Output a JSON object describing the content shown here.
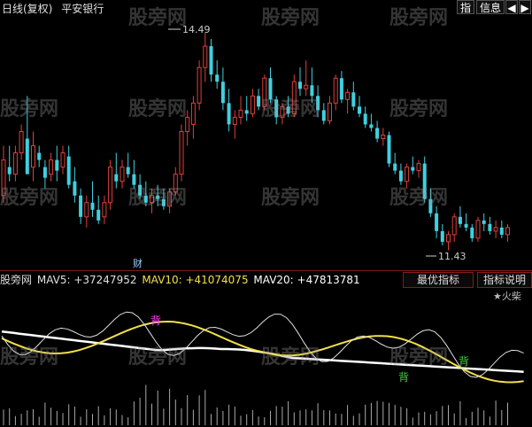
{
  "header": {
    "period": "日线(复权)",
    "stock_name": "平安银行",
    "btn_zhi": "指",
    "btn_info": "信息",
    "btn_prev": "◀",
    "btn_next": "▶"
  },
  "main": {
    "high_label": "14.49",
    "low_label": "11.43",
    "cai_label": "财",
    "candles": [
      [
        12.2,
        12.9,
        12.1,
        12.7
      ],
      [
        12.6,
        12.9,
        12.4,
        12.5
      ],
      [
        12.5,
        12.9,
        12.4,
        12.8
      ],
      [
        12.8,
        13.2,
        12.7,
        13.1
      ],
      [
        13.0,
        13.6,
        12.9,
        12.5
      ],
      [
        12.6,
        13.1,
        12.4,
        12.9
      ],
      [
        12.8,
        12.9,
        12.6,
        12.7
      ],
      [
        12.6,
        12.7,
        12.3,
        12.45
      ],
      [
        12.5,
        12.8,
        12.4,
        12.7
      ],
      [
        12.7,
        12.9,
        12.4,
        12.55
      ],
      [
        12.6,
        12.9,
        12.5,
        12.8
      ],
      [
        12.75,
        12.9,
        12.3,
        12.35
      ],
      [
        12.4,
        12.6,
        12.1,
        12.2
      ],
      [
        12.2,
        12.3,
        11.8,
        11.9
      ],
      [
        11.9,
        12.2,
        11.75,
        12.1
      ],
      [
        12.1,
        12.4,
        11.9,
        12.0
      ],
      [
        12.0,
        12.2,
        11.8,
        11.85
      ],
      [
        11.9,
        12.2,
        11.8,
        12.1
      ],
      [
        12.1,
        12.7,
        12.0,
        12.6
      ],
      [
        12.5,
        12.8,
        12.3,
        12.4
      ],
      [
        12.4,
        12.7,
        12.3,
        12.6
      ],
      [
        12.6,
        12.8,
        12.45,
        12.5
      ],
      [
        12.5,
        12.7,
        12.3,
        12.35
      ],
      [
        12.35,
        12.5,
        12.15,
        12.2
      ],
      [
        12.2,
        12.4,
        12.05,
        12.1
      ],
      [
        12.1,
        12.3,
        11.95,
        12.2
      ],
      [
        12.2,
        12.35,
        12.05,
        12.15
      ],
      [
        12.15,
        12.3,
        12.0,
        12.05
      ],
      [
        12.05,
        12.3,
        11.95,
        12.25
      ],
      [
        12.25,
        12.6,
        12.2,
        12.5
      ],
      [
        12.5,
        13.2,
        12.4,
        13.1
      ],
      [
        13.1,
        13.4,
        12.9,
        13.3
      ],
      [
        13.2,
        13.6,
        13.0,
        13.5
      ],
      [
        13.5,
        14.1,
        13.4,
        14.0
      ],
      [
        14.0,
        14.49,
        13.8,
        14.3
      ],
      [
        14.3,
        14.4,
        13.8,
        13.9
      ],
      [
        13.9,
        14.1,
        13.7,
        13.8
      ],
      [
        13.8,
        14.0,
        13.4,
        13.5
      ],
      [
        13.5,
        13.7,
        13.1,
        13.2
      ],
      [
        13.2,
        13.4,
        13.0,
        13.3
      ],
      [
        13.3,
        13.6,
        13.2,
        13.4
      ],
      [
        13.4,
        13.6,
        13.25,
        13.35
      ],
      [
        13.35,
        13.7,
        13.3,
        13.6
      ],
      [
        13.6,
        13.7,
        13.4,
        13.45
      ],
      [
        13.45,
        13.9,
        13.4,
        13.85
      ],
      [
        13.85,
        14.0,
        13.5,
        13.55
      ],
      [
        13.55,
        13.6,
        13.2,
        13.3
      ],
      [
        13.3,
        13.5,
        13.2,
        13.45
      ],
      [
        13.45,
        13.6,
        13.3,
        13.35
      ],
      [
        13.35,
        13.9,
        13.3,
        13.8
      ],
      [
        13.8,
        14.0,
        13.6,
        13.7
      ],
      [
        13.7,
        14.1,
        13.6,
        13.75
      ],
      [
        13.75,
        14.0,
        13.5,
        13.6
      ],
      [
        13.6,
        13.75,
        13.3,
        13.4
      ],
      [
        13.4,
        13.5,
        13.2,
        13.25
      ],
      [
        13.25,
        13.6,
        13.2,
        13.5
      ],
      [
        13.5,
        13.9,
        13.4,
        13.85
      ],
      [
        13.85,
        13.95,
        13.5,
        13.55
      ],
      [
        13.55,
        13.7,
        13.35,
        13.65
      ],
      [
        13.65,
        13.8,
        13.4,
        13.45
      ],
      [
        13.45,
        13.6,
        13.3,
        13.35
      ],
      [
        13.35,
        13.45,
        13.15,
        13.2
      ],
      [
        13.2,
        13.35,
        13.1,
        13.15
      ],
      [
        13.15,
        13.25,
        12.95,
        13.0
      ],
      [
        13.0,
        13.15,
        12.9,
        13.05
      ],
      [
        13.05,
        13.1,
        12.6,
        12.65
      ],
      [
        12.65,
        12.8,
        12.5,
        12.55
      ],
      [
        12.55,
        12.65,
        12.35,
        12.4
      ],
      [
        12.4,
        12.65,
        12.3,
        12.6
      ],
      [
        12.6,
        12.75,
        12.5,
        12.55
      ],
      [
        12.55,
        12.7,
        12.45,
        12.65
      ],
      [
        12.65,
        12.75,
        12.1,
        12.15
      ],
      [
        12.15,
        12.3,
        11.9,
        11.95
      ],
      [
        11.95,
        12.05,
        11.6,
        11.7
      ],
      [
        11.7,
        11.8,
        11.5,
        11.55
      ],
      [
        11.55,
        11.7,
        11.43,
        11.65
      ],
      [
        11.65,
        11.95,
        11.55,
        11.9
      ],
      [
        11.9,
        12.05,
        11.75,
        11.8
      ],
      [
        11.8,
        11.95,
        11.7,
        11.75
      ],
      [
        11.75,
        11.8,
        11.55,
        11.6
      ],
      [
        11.6,
        11.9,
        11.55,
        11.85
      ],
      [
        11.85,
        11.95,
        11.7,
        11.8
      ],
      [
        11.8,
        11.9,
        11.65,
        11.7
      ],
      [
        11.7,
        11.85,
        11.6,
        11.75
      ],
      [
        11.75,
        11.85,
        11.6,
        11.65
      ],
      [
        11.65,
        11.8,
        11.55,
        11.75
      ]
    ]
  },
  "legend": {
    "indicator": "股旁网",
    "mav5": "MAV5: +37247952",
    "mav10": "MAV10: +41074075",
    "mav20": "MAV20: +47813781"
  },
  "buttons": {
    "best": "最优指标",
    "explain": "指标说明"
  },
  "author": "★火柴",
  "sub": {
    "bei_label": "背",
    "colors": {
      "mav5": "#e0e0e0",
      "mav10": "#f2e04a",
      "mav20": "#ffffff",
      "bei1": "#ff40ff",
      "bei2": "#40d040",
      "tick": "#aaaaaa"
    }
  },
  "watermark": "股旁网"
}
